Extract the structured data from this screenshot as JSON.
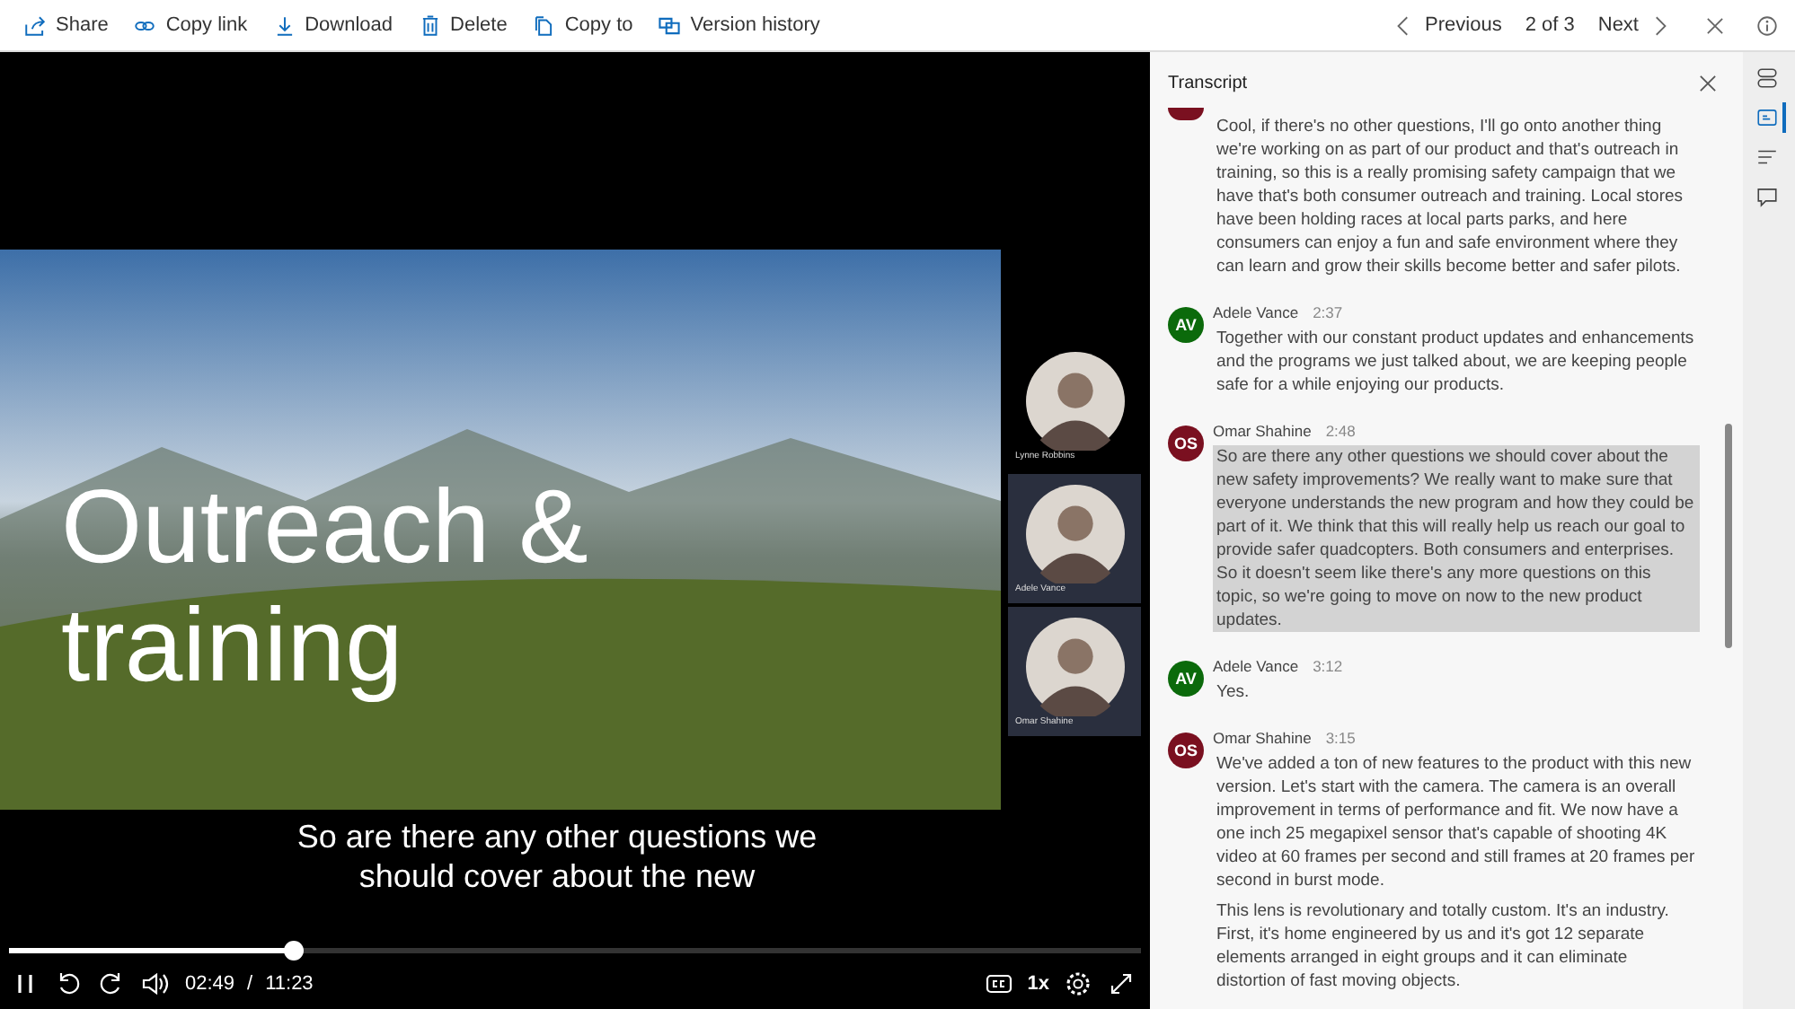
{
  "toolbar": {
    "actions": [
      {
        "kind": "share",
        "label": "Share"
      },
      {
        "kind": "link",
        "label": "Copy link"
      },
      {
        "kind": "download",
        "label": "Download"
      },
      {
        "kind": "delete",
        "label": "Delete"
      },
      {
        "kind": "copy",
        "label": "Copy to"
      },
      {
        "kind": "history",
        "label": "Version history"
      }
    ],
    "nav": {
      "previous": "Previous",
      "position": "2 of 3",
      "next": "Next"
    }
  },
  "video": {
    "slide": {
      "title": "Outreach & training"
    },
    "participants": [
      {
        "name": "Lynne Robbins",
        "selected": false
      },
      {
        "name": "Adele Vance",
        "selected": true
      },
      {
        "name": "Omar Shahine",
        "selected": true
      }
    ],
    "caption": "So are there any other questions we should cover about the new",
    "progress": {
      "level": 0.25
    },
    "current_time": "02:49",
    "separator": "/",
    "duration": "11:23",
    "speed": "1x"
  },
  "transcript": {
    "title": "Transcript",
    "entries": [
      {
        "color": "#7a1020",
        "selected": false,
        "paragraphs": [
          "Cool, if there's no other questions, I'll go onto another thing we're working on as part of our product and that's outreach in training, so this is a really promising safety campaign that we have that's both consumer outreach and training. Local stores have been holding races at local parts parks, and here consumers can enjoy a fun and safe environment where they can learn and grow their skills become better and safer pilots."
        ]
      },
      {
        "initials": "AV",
        "speaker": "Adele Vance",
        "time": "2:37",
        "color": "#0b6a0b",
        "selected": false,
        "paragraphs": [
          "Together with our constant product updates and enhancements and the programs we just talked about, we are keeping people safe for a while enjoying our products."
        ]
      },
      {
        "initials": "OS",
        "speaker": "Omar Shahine",
        "time": "2:48",
        "color": "#7a1020",
        "selected": true,
        "paragraphs": [
          "So are there any other questions we should cover about the new safety improvements? We really want to make sure that everyone understands the new program and how they could be part of it. We think that this will really help us reach our goal to provide safer quadcopters. Both consumers and enterprises. So it doesn't seem like there's any more questions on this topic, so we're going to move on now to the new product updates."
        ]
      },
      {
        "initials": "AV",
        "speaker": "Adele Vance",
        "time": "3:12",
        "color": "#0b6a0b",
        "selected": false,
        "paragraphs": [
          "Yes."
        ]
      },
      {
        "initials": "OS",
        "speaker": "Omar Shahine",
        "time": "3:15",
        "color": "#7a1020",
        "selected": false,
        "paragraphs": [
          "We've added a ton of new features to the product with this new version. Let's start with the camera. The camera is an overall improvement in terms of performance and fit. We now have a one inch 25 megapixel sensor that's capable of shooting 4K video at 60 frames per second and still frames at 20 frames per second in burst mode.",
          "This lens is revolutionary and totally custom. It's an industry. First, it's home engineered by us and it's got 12 separate elements arranged in eight groups and it can eliminate distortion of fast moving objects."
        ]
      }
    ]
  },
  "side_rail": [
    {
      "kind": "speakers",
      "selected": false
    },
    {
      "kind": "transcript",
      "selected": true
    },
    {
      "kind": "chapters",
      "selected": false
    },
    {
      "kind": "comments",
      "selected": false
    }
  ]
}
